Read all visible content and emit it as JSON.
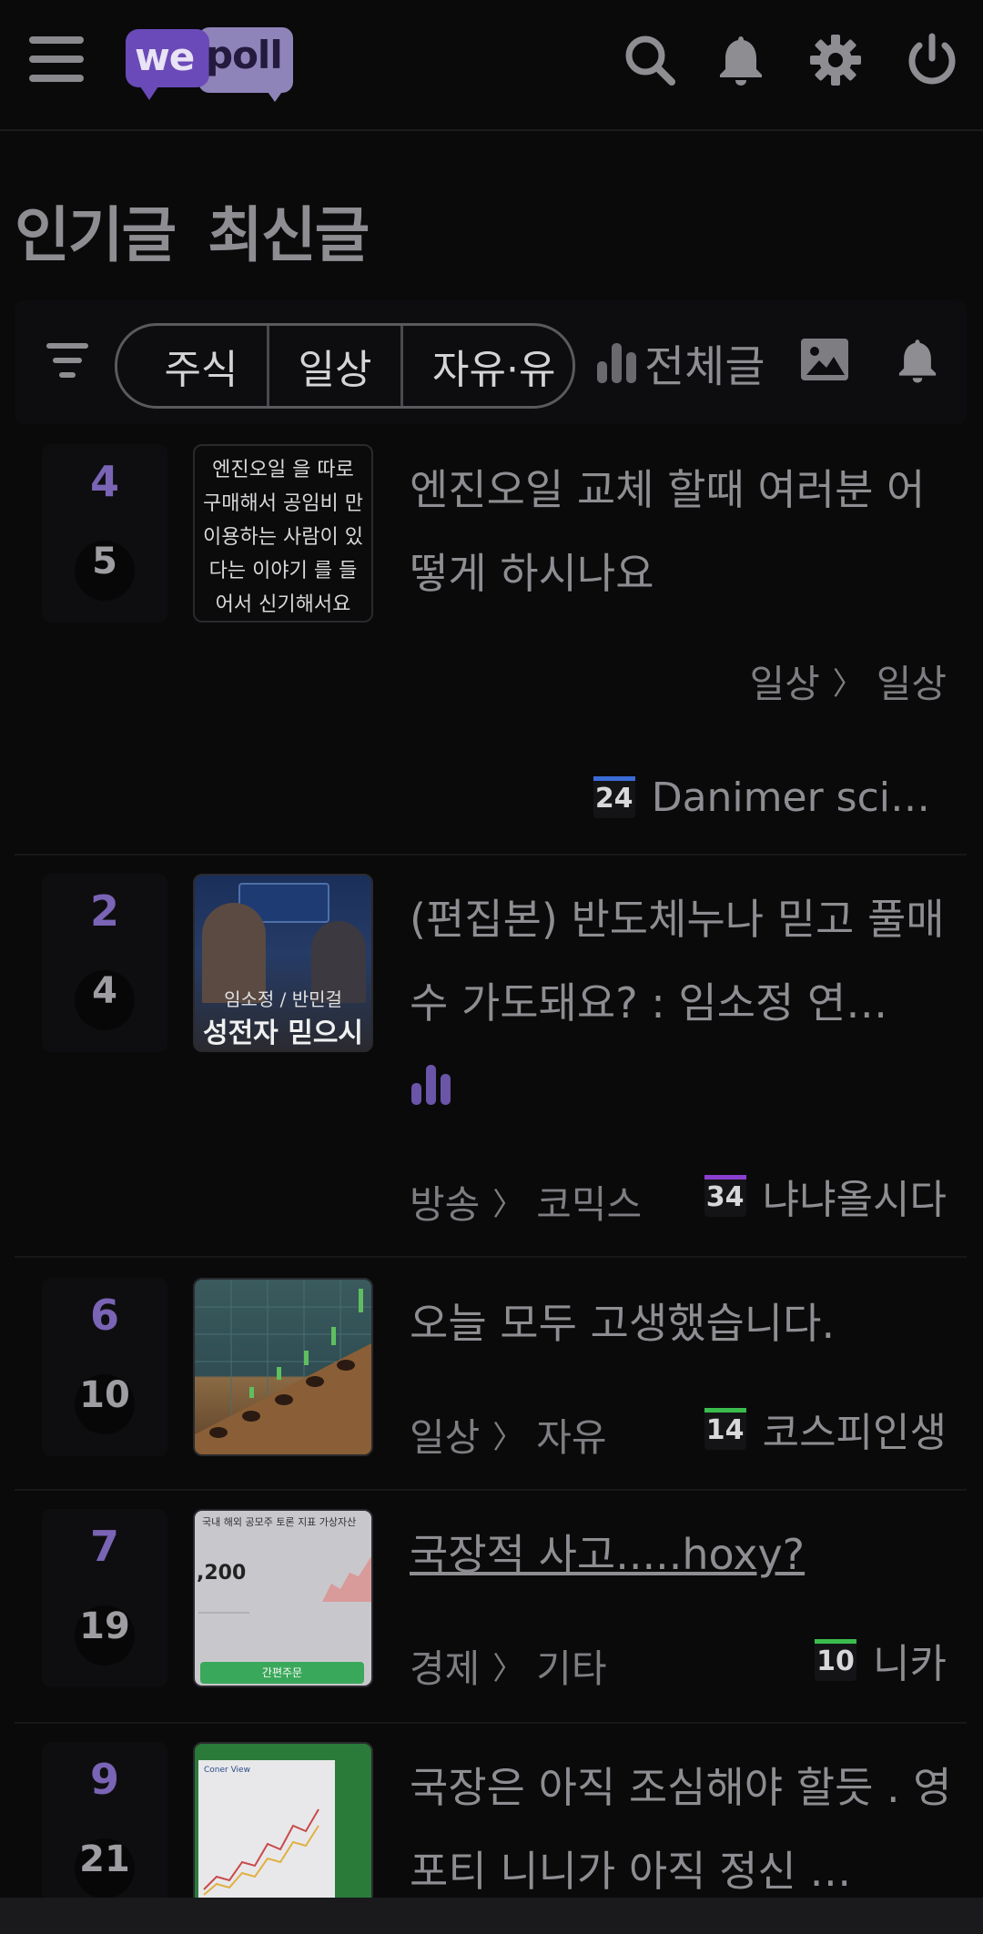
{
  "app": {
    "logo_left": "we",
    "logo_right": "poll"
  },
  "tabs": [
    "인기글",
    "최신글"
  ],
  "filters": {
    "chips": [
      "주식",
      "일상",
      "자유·유"
    ],
    "all_posts_label": "전체글"
  },
  "posts": [
    {
      "upvotes": "4",
      "comments": "5",
      "thumb_text": "엔진오일 을 따로 구매해서 공임비 만 이용하는 사람이 있다는 이야기 를 들어서 신기해서요",
      "title": "엔진오일 교체 할때 여러분 어떻게 하시나요",
      "category": "일상",
      "subcategory": "일상",
      "author_level": "24",
      "author": "Danimer sci…"
    },
    {
      "upvotes": "2",
      "comments": "4",
      "thumb_caption_small": "임소정 / 반민걸",
      "thumb_caption_big": "성전자 믿으시",
      "title": "(편집본) 반도체누나 믿고 풀매수 가도돼요? : 임소정 연…",
      "category": "방송",
      "subcategory": "코믹스",
      "author_level": "34",
      "author": "냐냐올시다"
    },
    {
      "upvotes": "6",
      "comments": "10",
      "title": "오늘 모두 고생했습니다.",
      "category": "일상",
      "subcategory": "자유",
      "author_level": "14",
      "author": "코스피인생"
    },
    {
      "upvotes": "7",
      "comments": "19",
      "thumb_tabs": "국내 해외 공모주 토론 지표 가상자산",
      "thumb_price": ",200",
      "thumb_button": "간편주문",
      "title": "국장적 사고.....hoxy?",
      "category": "경제",
      "subcategory": "기타",
      "author_level": "10",
      "author": "니카"
    },
    {
      "upvotes": "9",
      "comments": "21",
      "thumb_label": "Coner View",
      "title": "국장은 아직 조심해야 할듯 . 영포티 니니가 아직 정신 …"
    }
  ],
  "colors": {
    "accent": "#7a64b5",
    "level_blue": "#3a6bd6",
    "level_purple": "#8a3fd0",
    "level_green": "#3bbd4e"
  },
  "icons": [
    "menu-icon",
    "search-icon",
    "bell-icon",
    "gear-icon",
    "power-icon",
    "filter-icon",
    "bar-chart-icon",
    "image-icon",
    "bell-icon"
  ]
}
